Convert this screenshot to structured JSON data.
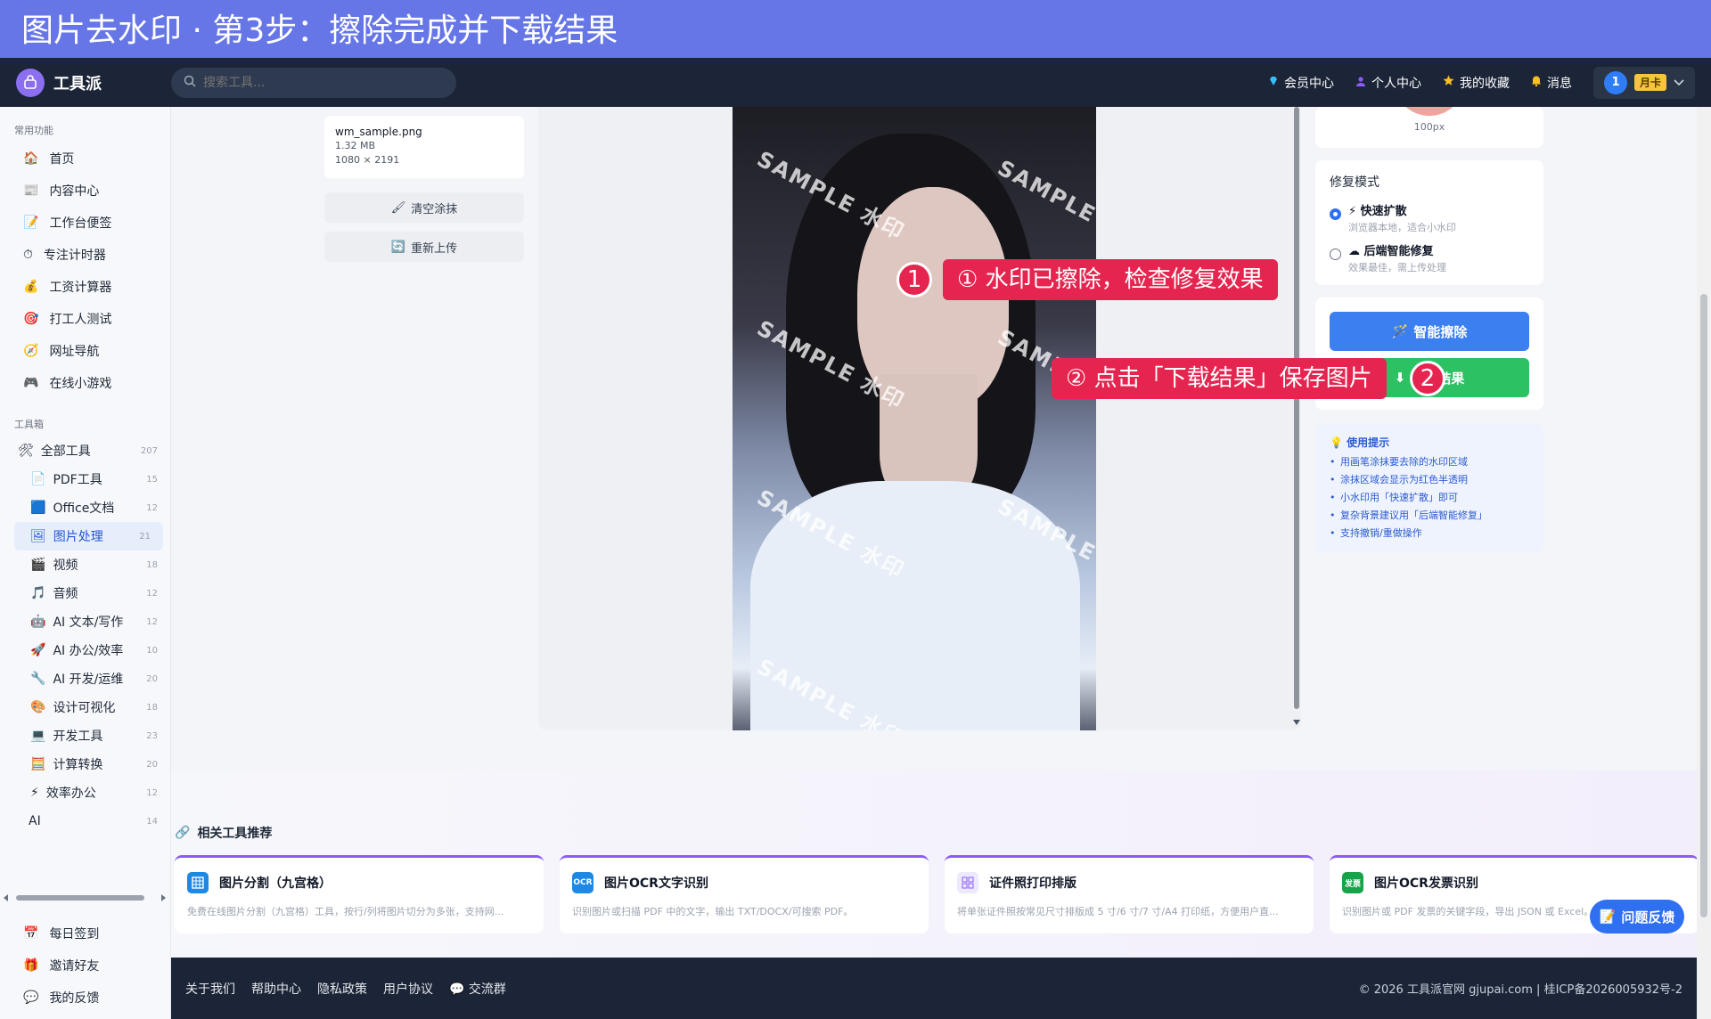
{
  "banner": {
    "title": "图片去水印 · 第3步：擦除完成并下载结果"
  },
  "topnav": {
    "brand": "工具派",
    "search_placeholder": "搜索工具...",
    "items": [
      {
        "label": "会员中心"
      },
      {
        "label": "个人中心"
      },
      {
        "label": "我的收藏"
      },
      {
        "label": "消息"
      }
    ],
    "avatar_text": "1",
    "card_badge": "月卡"
  },
  "sidebar": {
    "common_title": "常用功能",
    "common_items": [
      {
        "label": "首页"
      },
      {
        "label": "内容中心"
      },
      {
        "label": "工作台便签"
      },
      {
        "label": "专注计时器"
      },
      {
        "label": "工资计算器"
      },
      {
        "label": "打工人测试"
      },
      {
        "label": "网址导航"
      },
      {
        "label": "在线小游戏"
      }
    ],
    "toolbox_title": "工具箱",
    "all_tools": {
      "label": "全部工具",
      "count": "207"
    },
    "tools": [
      {
        "label": "PDF工具",
        "count": "15"
      },
      {
        "label": "Office文档",
        "count": "12"
      },
      {
        "label": "图片处理",
        "count": "21"
      },
      {
        "label": "视频",
        "count": "18"
      },
      {
        "label": "音频",
        "count": "12"
      },
      {
        "label": "AI 文本/写作",
        "count": "12"
      },
      {
        "label": "AI 办公/效率",
        "count": "10"
      },
      {
        "label": "AI 开发/运维",
        "count": "20"
      },
      {
        "label": "设计可视化",
        "count": "18"
      },
      {
        "label": "开发工具",
        "count": "23"
      },
      {
        "label": "计算转换",
        "count": "20"
      },
      {
        "label": "效率办公",
        "count": "12"
      },
      {
        "label": "AI",
        "count": "14"
      }
    ],
    "bottom_items": [
      {
        "label": "每日签到"
      },
      {
        "label": "邀请好友"
      },
      {
        "label": "我的反馈"
      }
    ]
  },
  "file": {
    "name": "wm_sample.png",
    "size": "1.32 MB",
    "dims": "1080 × 2191"
  },
  "left_buttons": {
    "clear": "清空涂抹",
    "reupload": "重新上传"
  },
  "canvas": {
    "watermark_text": "SAMPLE 水印"
  },
  "right": {
    "brush_size": "100px",
    "mode_title": "修复模式",
    "modes": [
      {
        "title": "快速扩散",
        "desc": "浏览器本地，适合小水印",
        "selected": true
      },
      {
        "title": "后端智能修复",
        "desc": "效果最佳，需上传处理",
        "selected": false
      }
    ],
    "erase_button": "智能擦除",
    "download_button": "下载结果",
    "tips_title": "使用提示",
    "tips": [
      "用画笔涂抹要去除的水印区域",
      "涂抹区域会显示为红色半透明",
      "小水印用「快速扩散」即可",
      "复杂背景建议用「后端智能修复」",
      "支持撤销/重做操作"
    ]
  },
  "annotations": [
    {
      "num": "1",
      "text": "① 水印已擦除，检查修复效果"
    },
    {
      "num": "2",
      "text": "② 点击「下载结果」保存图片"
    }
  ],
  "related": {
    "title": "相关工具推荐",
    "cards": [
      {
        "title": "图片分割（九宫格）",
        "desc": "免费在线图片分割（九宫格）工具，按行/列将图片切分为多张，支持网...",
        "icon_color": "#1e88e5",
        "icon_text": ""
      },
      {
        "title": "图片OCR文字识别",
        "desc": "识别图片或扫描 PDF 中的文字，输出 TXT/DOCX/可搜索 PDF。",
        "icon_color": "#1e88e5",
        "icon_text": "OCR"
      },
      {
        "title": "证件照打印排版",
        "desc": "将单张证件照按常见尺寸排版成 5 寸/6 寸/7 寸/A4 打印纸，方便用户直...",
        "icon_color": "#a78bfa",
        "icon_text": ""
      },
      {
        "title": "图片OCR发票识别",
        "desc": "识别图片或 PDF 发票的关键字段，导出 JSON 或 Excel。",
        "icon_color": "#16a34a",
        "icon_text": "发票"
      }
    ]
  },
  "feedback_button": "问题反馈",
  "footer": {
    "links": [
      "关于我们",
      "帮助中心",
      "隐私政策",
      "用户协议",
      "交流群"
    ],
    "copyright": "© 2026 工具派官网 gjupai.com | 桂ICP备2026005932号-2"
  },
  "colors": {
    "accent": "#3b7ff0",
    "success": "#2cc162",
    "annotation": "#e5254f",
    "banner": "#6676e6",
    "nav": "#1b2537"
  }
}
